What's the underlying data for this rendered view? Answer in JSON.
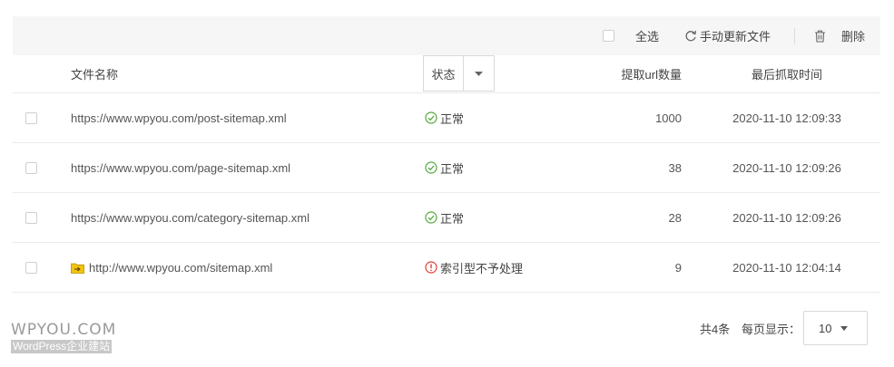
{
  "toolbar": {
    "select_all_label": "全选",
    "refresh_label": "手动更新文件",
    "delete_label": "删除"
  },
  "table": {
    "headers": {
      "filename": "文件名称",
      "status": "状态",
      "url_count": "提取url数量",
      "last_fetch": "最后抓取时间"
    },
    "rows": [
      {
        "url": "https://www.wpyou.com/post-sitemap.xml",
        "status": "正常",
        "status_type": "ok",
        "count": "1000",
        "time": "2020-11-10 12:09:33"
      },
      {
        "url": "https://www.wpyou.com/page-sitemap.xml",
        "status": "正常",
        "status_type": "ok",
        "count": "38",
        "time": "2020-11-10 12:09:26"
      },
      {
        "url": "https://www.wpyou.com/category-sitemap.xml",
        "status": "正常",
        "status_type": "ok",
        "count": "28",
        "time": "2020-11-10 12:09:26"
      },
      {
        "url": "http://www.wpyou.com/sitemap.xml",
        "status": "索引型不予处理",
        "status_type": "warn",
        "count": "9",
        "time": "2020-11-10 12:04:14",
        "icon": "index-folder-icon"
      }
    ]
  },
  "pagination": {
    "total": "共4条",
    "per_page_label": "每页显示：",
    "per_page_value": "10"
  },
  "watermark": {
    "title": "WPYOU.COM",
    "subtitle": "WordPress企业建站"
  },
  "colors": {
    "ok": "#52a83c",
    "warn": "#e53935",
    "folder": "#f2c40f"
  }
}
